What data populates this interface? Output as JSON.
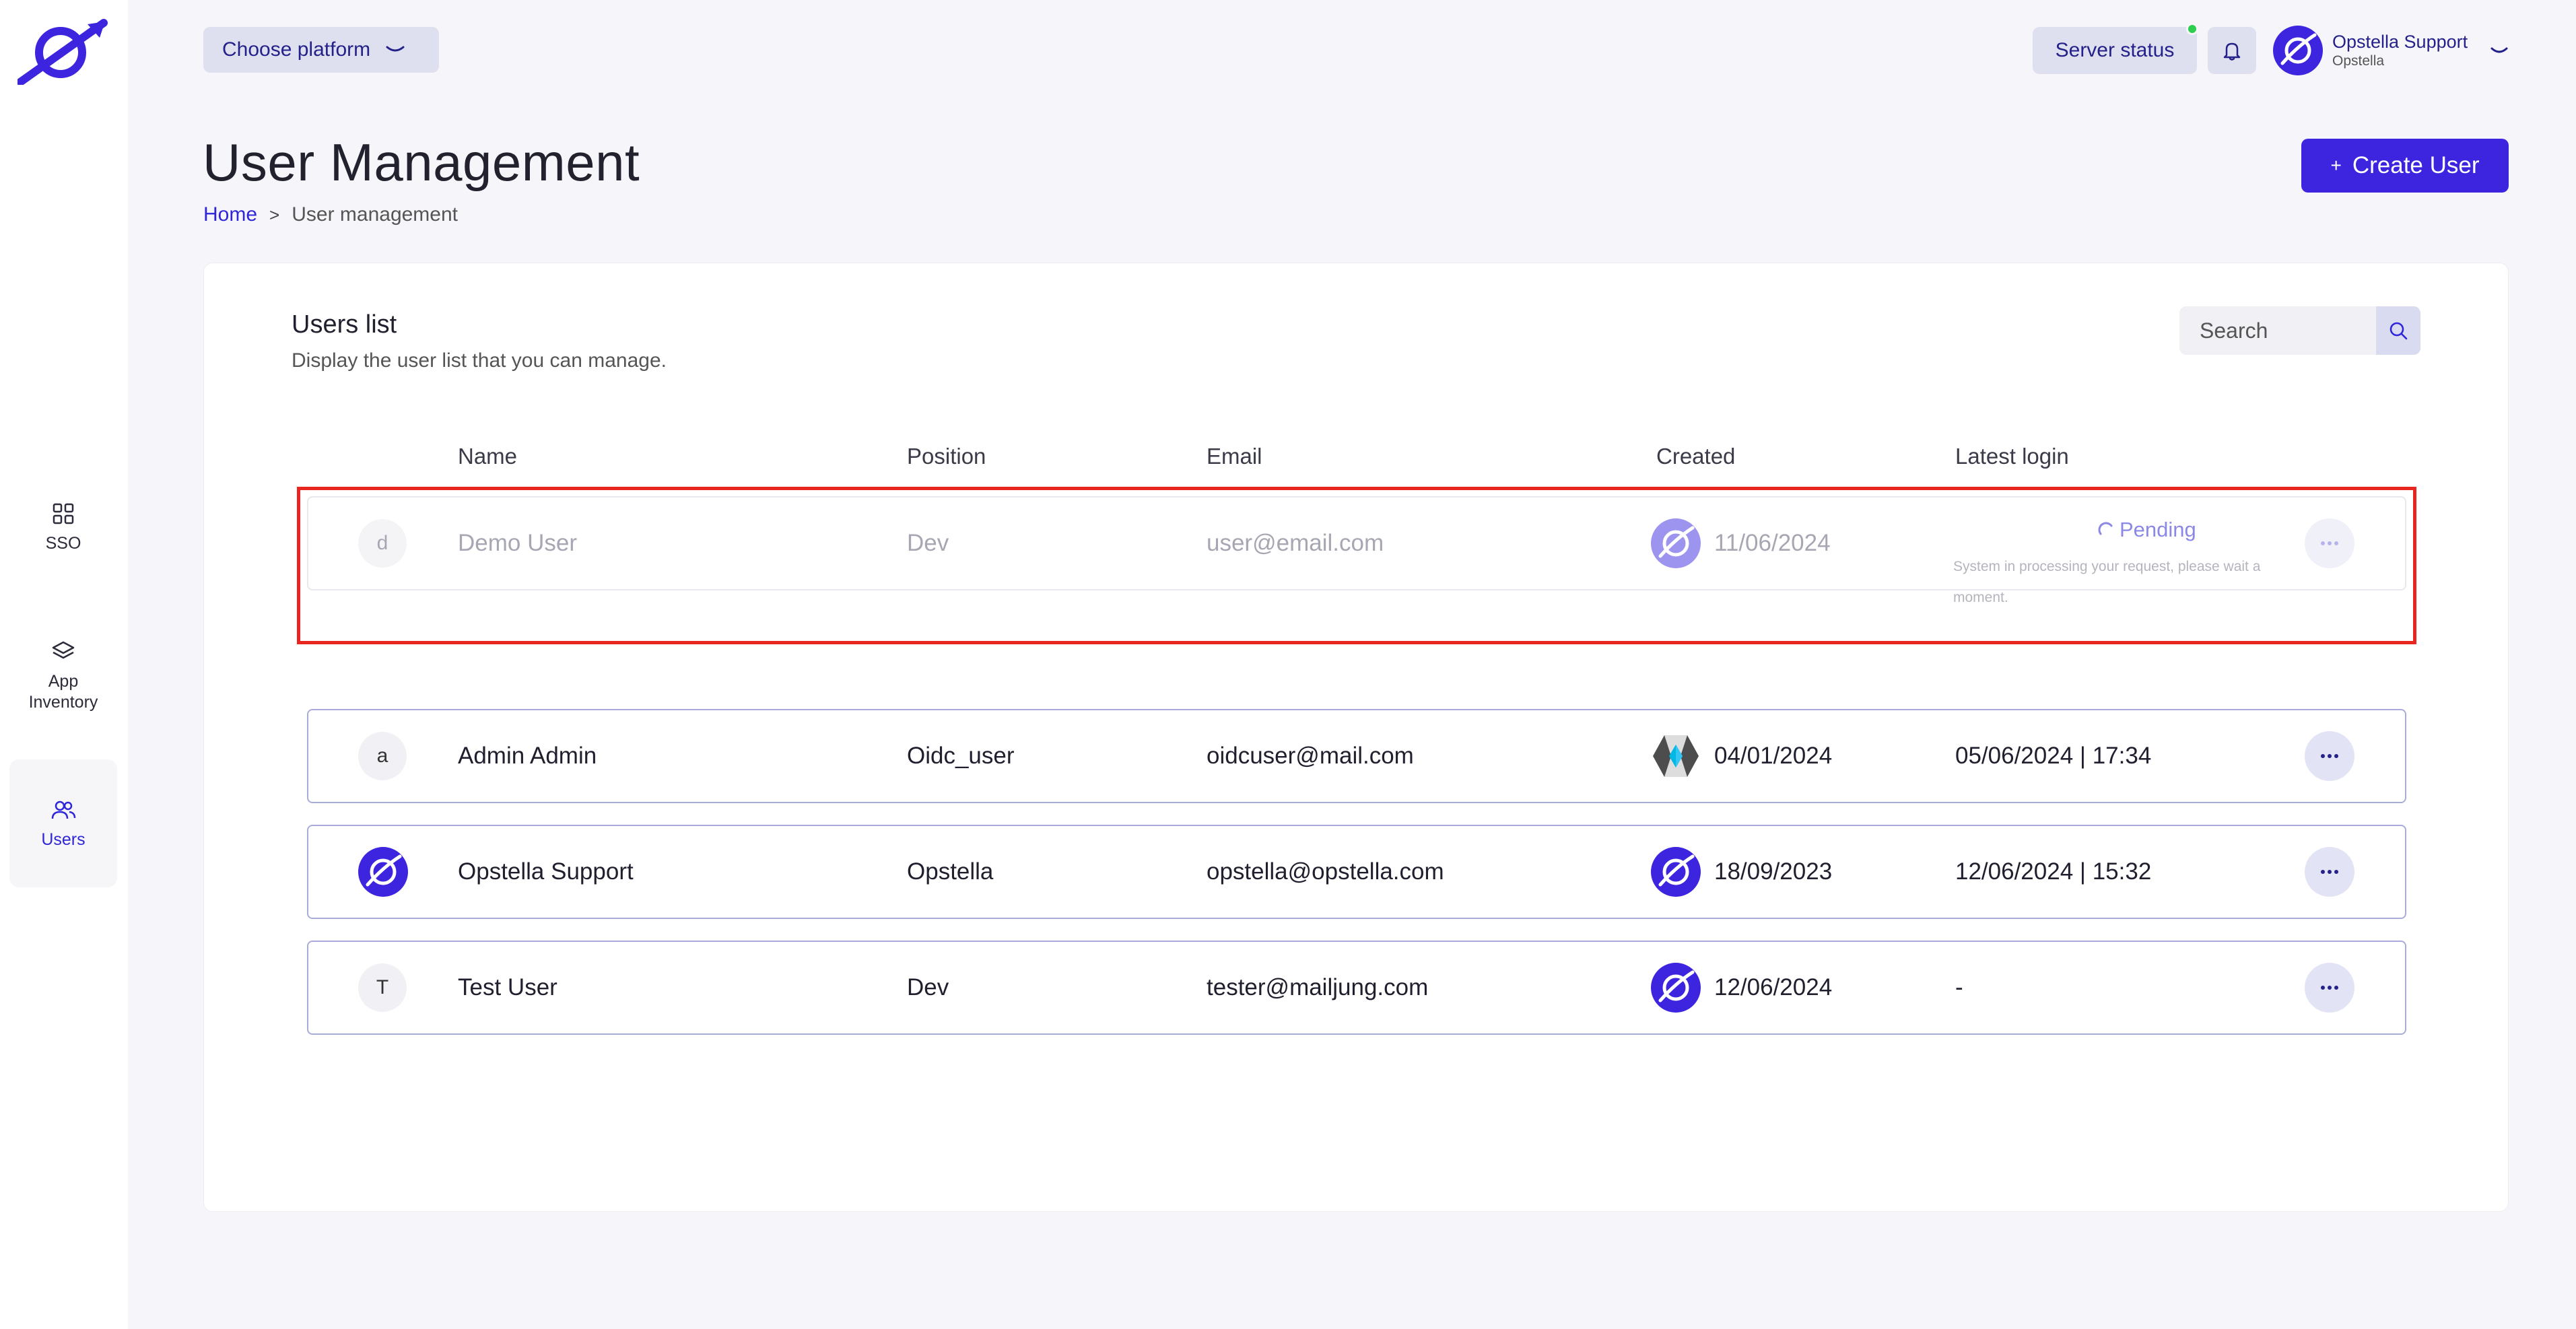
{
  "sidebar": {
    "items": [
      {
        "label": "SSO",
        "icon": "grid-icon"
      },
      {
        "label": "App\nInventory",
        "icon": "layers-icon"
      },
      {
        "label": "Users",
        "icon": "users-icon",
        "active": true
      }
    ]
  },
  "header": {
    "platform_label": "Choose platform",
    "server_status_label": "Server status",
    "server_status_color": "#2ecc4f",
    "user_name": "Opstella Support",
    "user_org": "Opstella"
  },
  "page": {
    "title": "User Management",
    "breadcrumb_home": "Home",
    "breadcrumb_sep": ">",
    "breadcrumb_current": "User management",
    "create_label": "Create User",
    "create_icon": "+"
  },
  "users_card": {
    "title": "Users list",
    "subtitle": "Display the user list that you can manage.",
    "search_placeholder": "Search",
    "columns": {
      "name": "Name",
      "position": "Position",
      "email": "Email",
      "created": "Created",
      "latest_login": "Latest login"
    },
    "rows": [
      {
        "initial": "d",
        "name": "Demo User",
        "position": "Dev",
        "email": "user@email.com",
        "created": "11/06/2024",
        "source": "opstella",
        "status": "Pending",
        "status_note": "System in processing your request, please wait a moment."
      },
      {
        "initial": "a",
        "name": "Admin Admin",
        "position": "Oidc_user",
        "email": "oidcuser@mail.com",
        "created": "04/01/2024",
        "source": "keycloak",
        "latest_login": "05/06/2024 | 17:34"
      },
      {
        "initial": "",
        "name": "Opstella Support",
        "position": "Opstella",
        "email": "opstella@opstella.com",
        "created": "18/09/2023",
        "source": "opstella",
        "latest_login": "12/06/2024 | 15:32"
      },
      {
        "initial": "T",
        "name": "Test User",
        "position": "Dev",
        "email": "tester@mailjung.com",
        "created": "12/06/2024",
        "source": "opstella",
        "latest_login": "-"
      }
    ]
  },
  "colors": {
    "brand": "#3d25e0",
    "brand_text": "#24218a",
    "highlight": "#e8251f",
    "row_border": "#a9acd9"
  }
}
